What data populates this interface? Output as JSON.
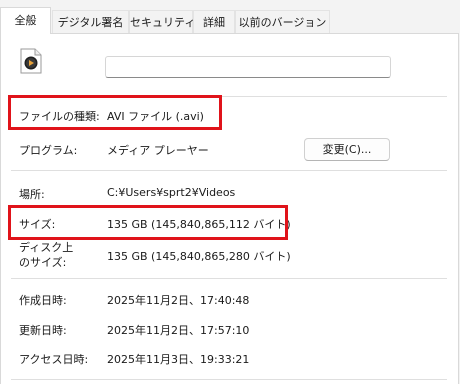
{
  "tabs": [
    "全般",
    "デジタル署名",
    "セキュリティ",
    "詳細",
    "以前のバージョン"
  ],
  "active_tab": "全般",
  "file_icon": "video-file-icon",
  "file_name_value": "",
  "properties": {
    "type_label": "ファイルの種類:",
    "type_value": "AVI ファイル (.avi)",
    "program_label": "プログラム:",
    "program_value": "メディア プレーヤー",
    "change_button": "変更(C)...",
    "location_label": "場所:",
    "location_value": "C:¥Users¥sprt2¥Videos",
    "size_label": "サイズ:",
    "size_value": "135 GB (145,840,865,112 バイト)",
    "disk_size_label_line1": "ディスク上",
    "disk_size_label_line2": "のサイズ:",
    "disk_size_value": "135 GB (145,840,865,280 バイト)",
    "created_label": "作成日時:",
    "created_value": "2025年11月2日、17:40:48",
    "modified_label": "更新日時:",
    "modified_value": "2025年11月2日、17:57:10",
    "accessed_label": "アクセス日時:",
    "accessed_value": "2025年11月3日、19:33:21"
  },
  "highlight_color": "#e0131a"
}
